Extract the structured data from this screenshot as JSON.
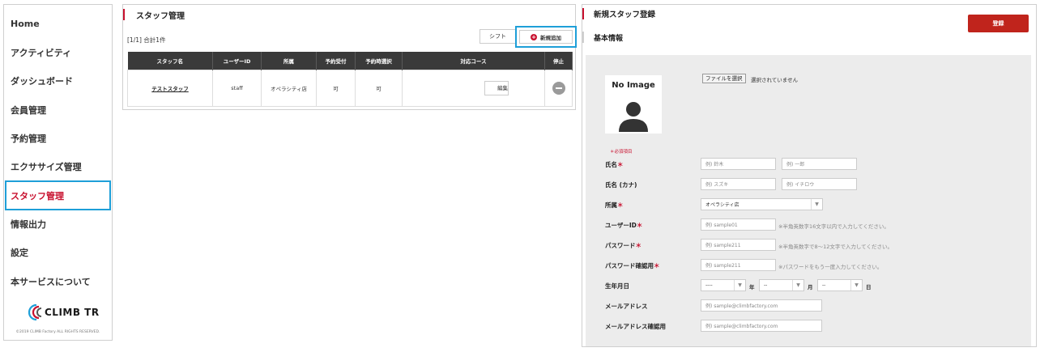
{
  "sidebar": {
    "items": [
      {
        "label": "Home",
        "active": false
      },
      {
        "label": "アクティビティ",
        "active": false
      },
      {
        "label": "ダッシュボード",
        "active": false
      },
      {
        "label": "会員管理",
        "active": false
      },
      {
        "label": "予約管理",
        "active": false
      },
      {
        "label": "エクササイズ管理",
        "active": false
      },
      {
        "label": "スタッフ管理",
        "active": true
      },
      {
        "label": "情報出力",
        "active": false
      },
      {
        "label": "設定",
        "active": false
      },
      {
        "label": "本サービスについて",
        "active": false
      }
    ],
    "logo_text": "CLIMB TR",
    "copyright": "©2019 CLIMB Factory ALL RIGHTS RESERVED."
  },
  "staff_panel": {
    "title": "スタッフ管理",
    "count": "[1/1] 合計1件",
    "shift_label": "シフト",
    "new_label": "新規追加",
    "columns": [
      "スタッフ名",
      "ユーザーID",
      "所属",
      "予約受付",
      "予約時選択",
      "対応コース",
      "停止"
    ],
    "rows": [
      {
        "name": "テストスタッフ",
        "user_id": "staff",
        "affiliation": "オペラシティ店",
        "reservation": "可",
        "selectable": "可",
        "courses": "",
        "edit_label": "編集"
      }
    ]
  },
  "form": {
    "title": "新規スタッフ登録",
    "register_label": "登録",
    "section": "基本情報",
    "photo_label": "No Image",
    "file_button": "ファイルを選択",
    "file_status": "選択されていません",
    "required_note": "＊必須項目",
    "required_mark": "＊",
    "name_label": "氏名",
    "name_last_ph": "例) 鈴木",
    "name_first_ph": "例) 一郎",
    "kana_label": "氏名 (カナ)",
    "kana_last_ph": "例) スズキ",
    "kana_first_ph": "例) イチロウ",
    "affiliation_label": "所属",
    "affiliation_value": "オペラシティ店",
    "userid_label": "ユーザーID",
    "userid_ph": "例) sample01",
    "userid_hint": "※半角英数字16文字以内で入力してください。",
    "password_label": "パスワード",
    "password_ph": "例) sample211",
    "password_hint": "※半角英数字で8～12文字で入力してください。",
    "password_confirm_label": "パスワード確認用",
    "password_confirm_ph": "例) sample211",
    "password_confirm_hint": "※パスワードをもう一度入力してください。",
    "birthday_label": "生年月日",
    "year_value": "----",
    "year_unit": "年",
    "month_value": "--",
    "month_unit": "月",
    "day_value": "--",
    "day_unit": "日",
    "email_label": "メールアドレス",
    "email_ph": "例) sample@climbfactory.com",
    "email_confirm_label": "メールアドレス確認用",
    "email_confirm_ph": "例) sample@climbfactory.com"
  }
}
